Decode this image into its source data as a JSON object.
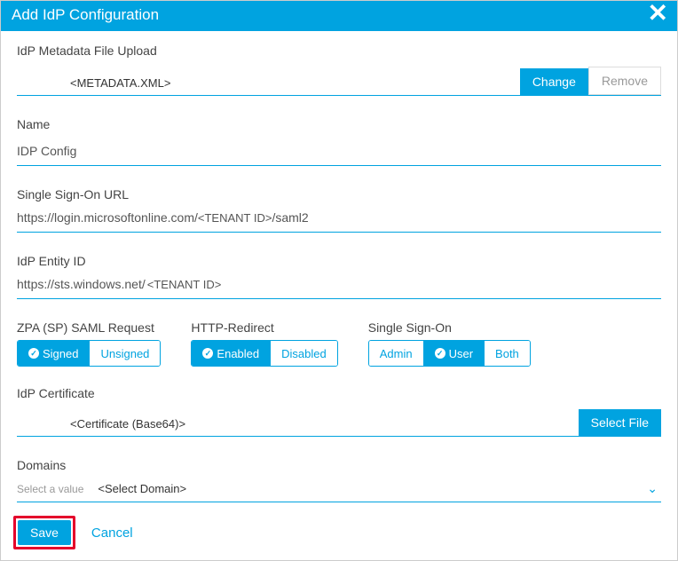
{
  "header": {
    "title": "Add IdP Configuration",
    "close_icon": "✕"
  },
  "metadata": {
    "label": "IdP Metadata File Upload",
    "placeholder": "<METADATA.XML>",
    "change_btn": "Change",
    "remove_btn": "Remove"
  },
  "name": {
    "label": "Name",
    "value": "IDP Config"
  },
  "sso_url": {
    "label": "Single Sign-On URL",
    "prefix": "https://login.microsoftonline.com/",
    "token": "<TENANT ID>",
    "suffix": "/saml2"
  },
  "entity_id": {
    "label": "IdP Entity ID",
    "prefix": "https://sts.windows.net/",
    "token": "<TENANT ID>"
  },
  "saml_request": {
    "label": "ZPA (SP) SAML Request",
    "signed": "Signed",
    "unsigned": "Unsigned"
  },
  "http_redirect": {
    "label": "HTTP-Redirect",
    "enabled": "Enabled",
    "disabled": "Disabled"
  },
  "single_sign_on": {
    "label": "Single Sign-On",
    "admin": "Admin",
    "user": "User",
    "both": "Both"
  },
  "certificate": {
    "label": "IdP Certificate",
    "placeholder": "<Certificate (Base64)>",
    "select_btn": "Select File"
  },
  "domains": {
    "label": "Domains",
    "hint": "Select a value",
    "value": "<Select Domain>"
  },
  "footer": {
    "save": "Save",
    "cancel": "Cancel"
  }
}
